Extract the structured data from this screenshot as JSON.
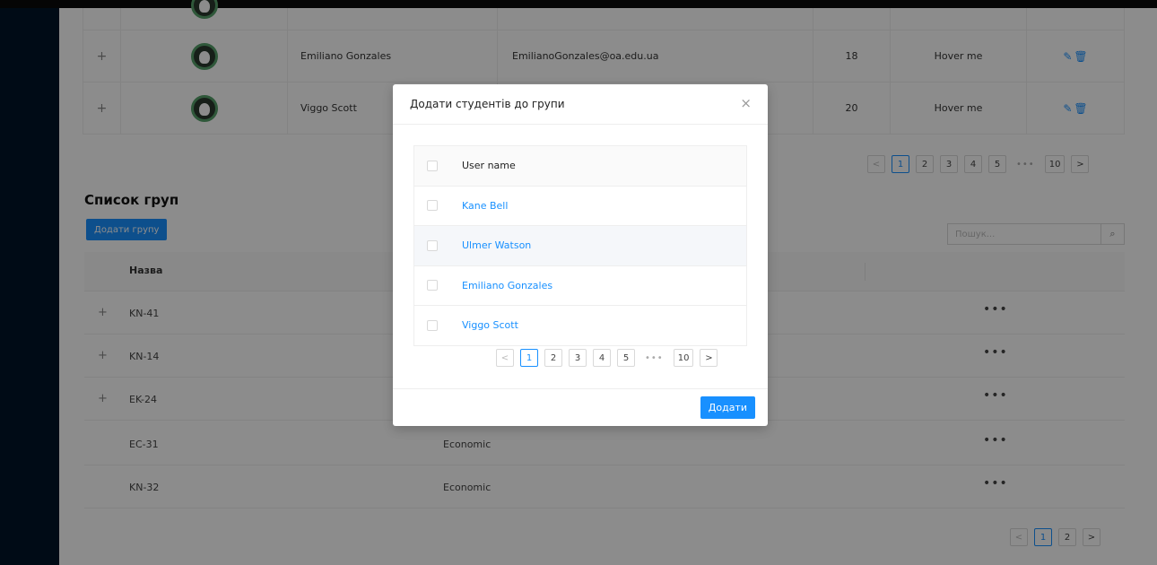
{
  "students": [
    {
      "name": "",
      "email": "",
      "age": "",
      "hover": ""
    },
    {
      "name": "Emiliano Gonzales",
      "email": "EmilianoGonzales@oa.edu.ua",
      "age": "18",
      "hover": "Hover me"
    },
    {
      "name": "Viggo Scott",
      "email": "",
      "age": "20",
      "hover": "Hover me"
    }
  ],
  "student_pager": {
    "pages": [
      "1",
      "2",
      "3",
      "4",
      "5",
      "10"
    ],
    "prev": "<",
    "next": ">",
    "dots": "•••"
  },
  "groups_section": {
    "title": "Список груп",
    "add_button": "Додати групу",
    "search_placeholder": "Пошук...",
    "col_name": "Назва"
  },
  "groups": [
    {
      "expand": "+",
      "name": "KN-41",
      "faculty": "",
      "more": "•••"
    },
    {
      "expand": "+",
      "name": "KN-14",
      "faculty": "",
      "more": "•••"
    },
    {
      "expand": "+",
      "name": "EK-24",
      "faculty": "",
      "more": "•••"
    },
    {
      "expand": "",
      "name": "EC-31",
      "faculty": "Economic",
      "more": "•••"
    },
    {
      "expand": "",
      "name": "KN-32",
      "faculty": "Economic",
      "more": "•••"
    }
  ],
  "group_pager": {
    "pages": [
      "1",
      "2"
    ],
    "prev": "<",
    "next": ">"
  },
  "modal": {
    "title": "Додати студентів до групи",
    "close": "×",
    "column": "User name",
    "users": [
      "Kane Bell",
      "Ulmer Watson",
      "Emiliano Gonzales",
      "Viggo Scott"
    ],
    "pager": {
      "pages": [
        "1",
        "2",
        "3",
        "4",
        "5",
        "10"
      ],
      "prev": "<",
      "next": ">",
      "dots": "•••"
    },
    "submit": "Додати"
  },
  "icons": {
    "edit": "pencil-icon",
    "delete": "trash-icon",
    "search": "search-icon",
    "close": "close-icon"
  },
  "colors": {
    "primary": "#1890ff",
    "sidebar": "#001529",
    "overlay": "rgba(0,0,0,0.45)"
  }
}
